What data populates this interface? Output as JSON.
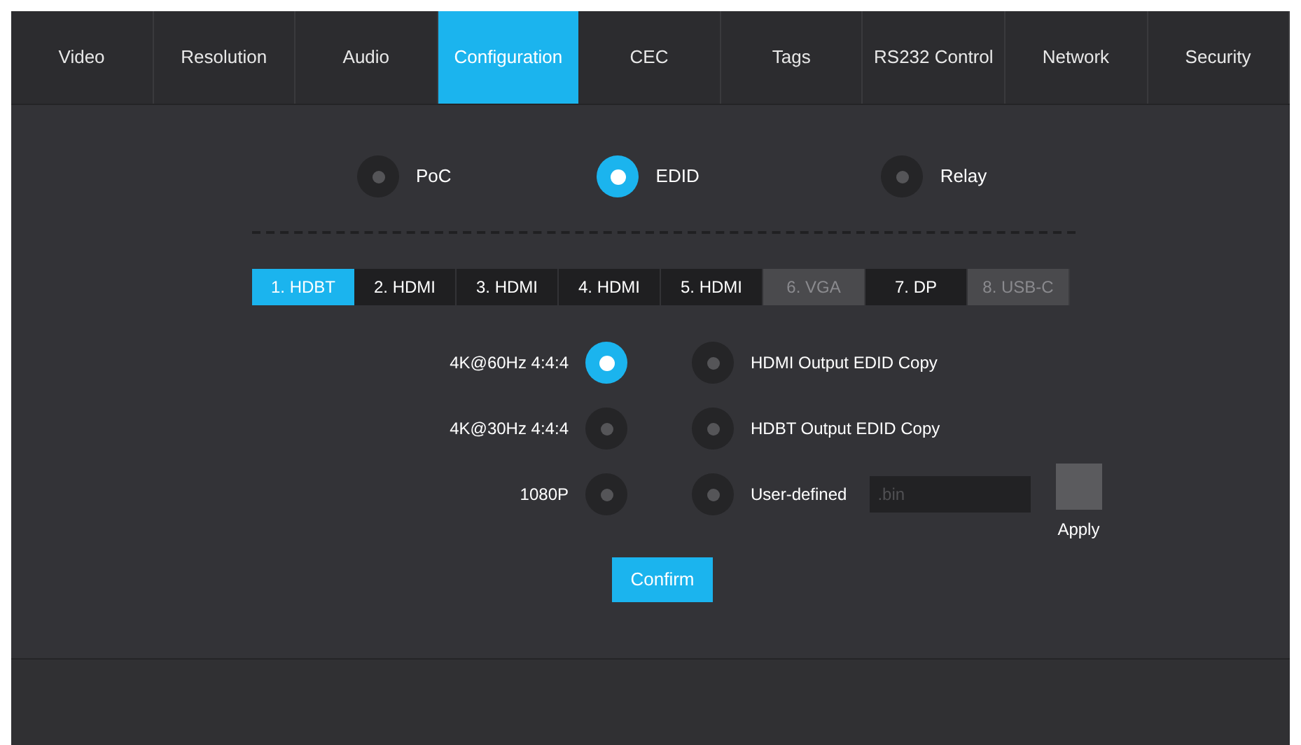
{
  "tabs": [
    {
      "label": "Video",
      "selected": false
    },
    {
      "label": "Resolution",
      "selected": false
    },
    {
      "label": "Audio",
      "selected": false
    },
    {
      "label": "Configuration",
      "selected": true
    },
    {
      "label": "CEC",
      "selected": false
    },
    {
      "label": "Tags",
      "selected": false
    },
    {
      "label": "RS232 Control",
      "selected": false
    },
    {
      "label": "Network",
      "selected": false
    },
    {
      "label": "Security",
      "selected": false
    }
  ],
  "modes": [
    {
      "label": "PoC",
      "selected": false
    },
    {
      "label": "EDID",
      "selected": true
    },
    {
      "label": "Relay",
      "selected": false
    }
  ],
  "ports": [
    {
      "label": "1. HDBT",
      "selected": true,
      "disabled": false
    },
    {
      "label": "2. HDMI",
      "selected": false,
      "disabled": false
    },
    {
      "label": "3. HDMI",
      "selected": false,
      "disabled": false
    },
    {
      "label": "4. HDMI",
      "selected": false,
      "disabled": false
    },
    {
      "label": "5. HDMI",
      "selected": false,
      "disabled": false
    },
    {
      "label": "6. VGA",
      "selected": false,
      "disabled": true
    },
    {
      "label": "7. DP",
      "selected": false,
      "disabled": false
    },
    {
      "label": "8. USB-C",
      "selected": false,
      "disabled": true
    }
  ],
  "edid_presets": [
    {
      "label": "4K@60Hz 4:4:4",
      "selected": true
    },
    {
      "label": "4K@30Hz 4:4:4",
      "selected": false
    },
    {
      "label": "1080P",
      "selected": false
    }
  ],
  "edid_sources": [
    {
      "kind": "copy",
      "label": "HDMI Output EDID Copy",
      "selected": false
    },
    {
      "kind": "copy",
      "label": "HDBT Output EDID Copy",
      "selected": false
    },
    {
      "kind": "file",
      "label": "User-defined",
      "selected": false,
      "placeholder": ".bin",
      "apply": "Apply"
    }
  ],
  "confirm": "Confirm"
}
